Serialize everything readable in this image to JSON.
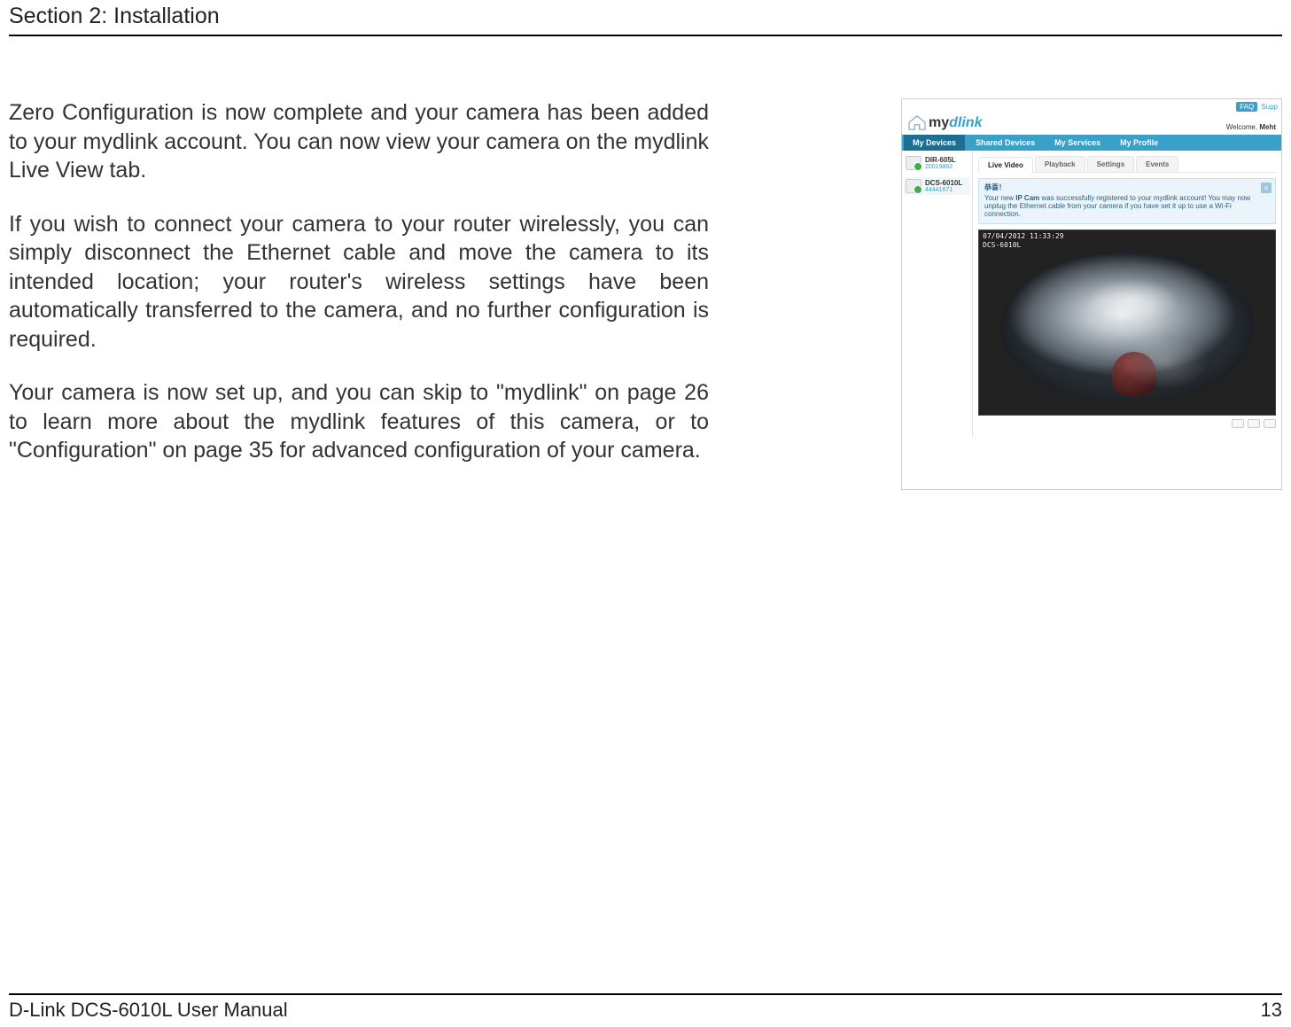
{
  "header": {
    "section_title": "Section 2: Installation"
  },
  "body": {
    "p1": "Zero Configuration is now complete and your camera has been added to your mydlink account. You can now view your camera on the mydlink Live View tab.",
    "p2": "If you wish to connect your camera to your router wirelessly, you can simply disconnect the Ethernet cable and move the camera to its intended location; your router's wireless settings have been automatically transferred to the camera, and no further configuration is required.",
    "p3": "Your camera is now set up, and you can skip to \"mydlink\" on page 26 to learn more about the mydlink features of this camera, or to \"Configuration\" on page 35 for advanced configuration of your camera."
  },
  "screenshot": {
    "top_links": {
      "faq": "FAQ",
      "support": "Supp"
    },
    "logo": {
      "prefix": "my",
      "brand": "dlink"
    },
    "welcome": {
      "prefix": "Welcome, ",
      "name": "Meht"
    },
    "nav": {
      "items": [
        "My Devices",
        "Shared Devices",
        "My Services",
        "My Profile"
      ],
      "active_index": 0
    },
    "sidebar": {
      "devices": [
        {
          "name": "DIR-605L",
          "id": "20019862"
        },
        {
          "name": "DCS-6010L",
          "id": "44441671"
        }
      ],
      "active_index": 1
    },
    "tabs": {
      "items": [
        "Live Video",
        "Playback",
        "Settings",
        "Events"
      ],
      "active_index": 0
    },
    "alert": {
      "title": "恭喜！",
      "msg_a": "Your new ",
      "msg_b": "IP Cam",
      "msg_c": " was successfully registered to your mydlink account! You may now unplug the Ethernet cable from your camera if you have set it up to use a Wi-Fi connection.",
      "close": "×"
    },
    "osd": {
      "line1": "07/04/2012 11:33:29",
      "line2": "DCS-6010L"
    }
  },
  "footer": {
    "manual": "D-Link DCS-6010L User Manual",
    "page": "13"
  }
}
